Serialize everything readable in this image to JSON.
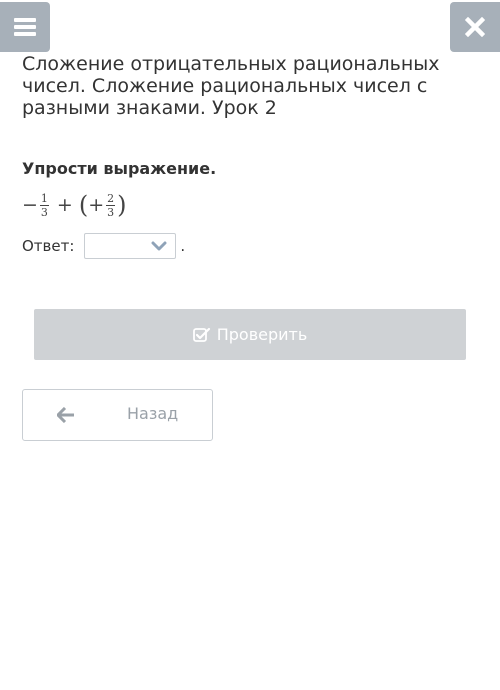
{
  "header": {
    "menu_icon": "menu-icon",
    "close_icon": "close-icon",
    "icon_color": "#a7b0b9"
  },
  "lesson": {
    "title": "Сложение отрицательных рациональных чисел. Сложение рациональных чисел с разными знаками. Урок 2"
  },
  "task": {
    "heading": "Упрости выражение.",
    "expression": {
      "sign1": "−",
      "frac1_num": "1",
      "frac1_den": "3",
      "operator": "+",
      "paren_open": "(",
      "sign2": "+",
      "frac2_num": "2",
      "frac2_den": "3",
      "paren_close": ")"
    },
    "answer_label": "Ответ:",
    "answer_value": "",
    "answer_suffix": "."
  },
  "actions": {
    "check_label": "Проверить",
    "check_icon": "checkbox-check-icon",
    "back_label": "Назад",
    "back_icon": "arrow-left-icon"
  }
}
